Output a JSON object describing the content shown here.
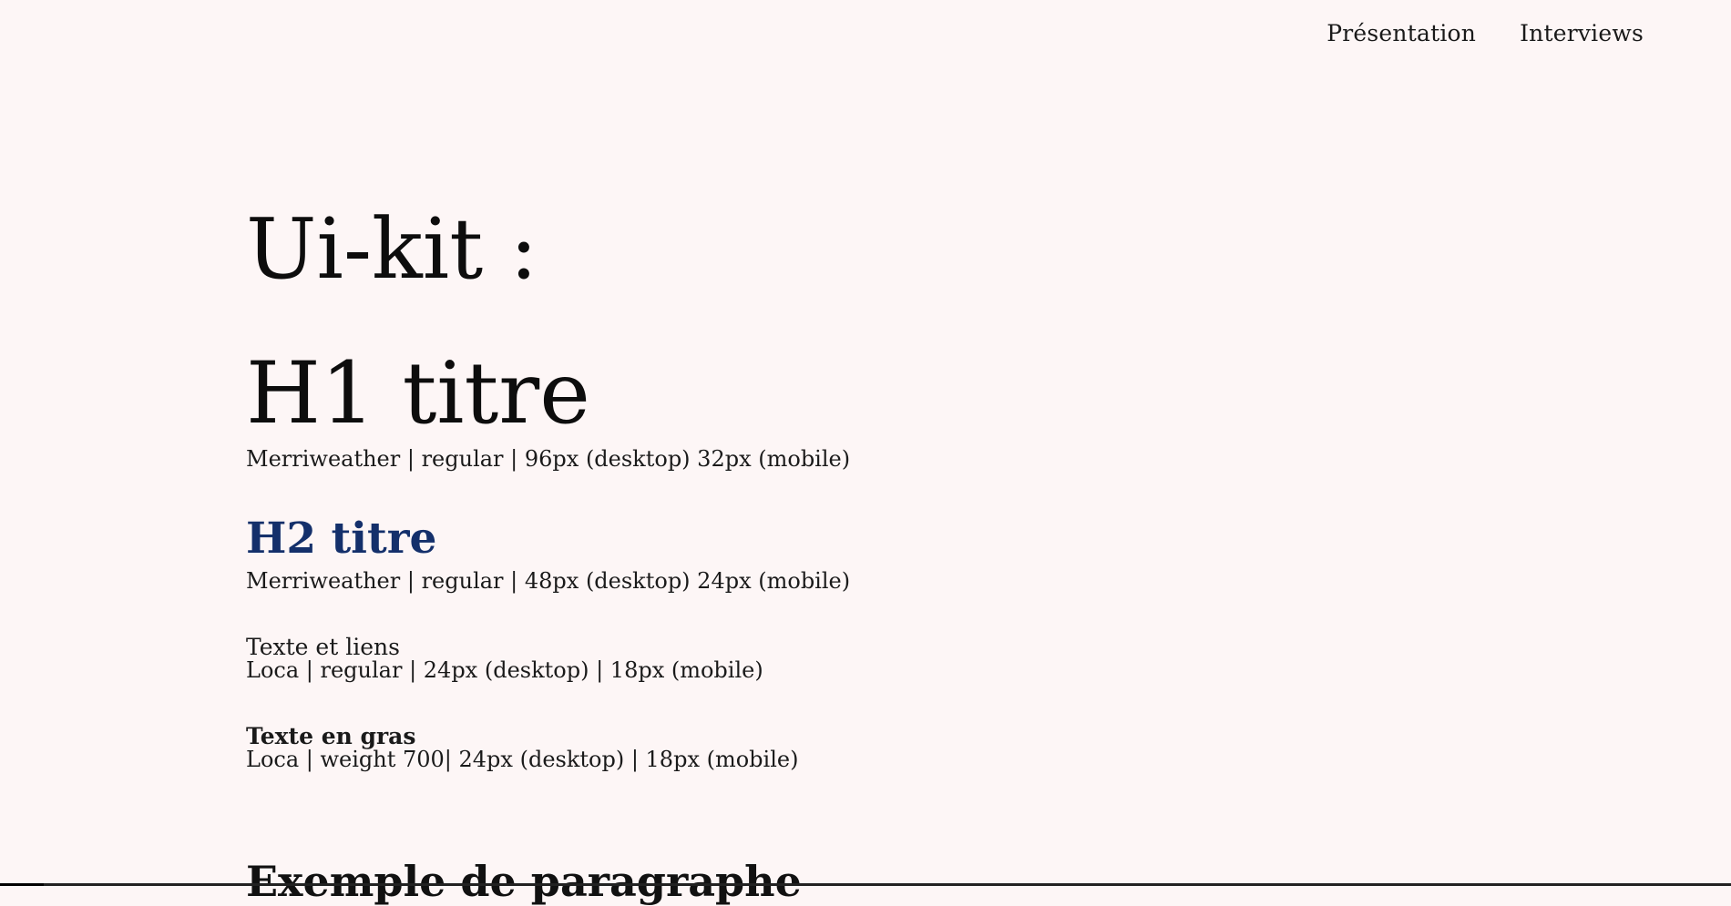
{
  "nav": {
    "items": [
      {
        "label": "Présentation"
      },
      {
        "label": "Interviews"
      }
    ]
  },
  "page": {
    "title": "Ui-kit :"
  },
  "samples": {
    "h1": {
      "label": "H1 titre",
      "spec": "Merriweather | regular | 96px (desktop) 32px (mobile)"
    },
    "h2": {
      "label": "H2 titre",
      "spec": "Merriweather | regular | 48px (desktop) 24px (mobile)"
    },
    "text": {
      "label": "Texte et liens",
      "spec": "Loca | regular | 24px (desktop) | 18px (mobile)"
    },
    "bold": {
      "label": "Texte en gras",
      "spec": "Loca | weight 700| 24px (desktop) | 18px (mobile)"
    },
    "paragraph": {
      "heading": "Exemple de paragraphe"
    }
  },
  "colors": {
    "background": "#fdf6f6",
    "h2": "#14306b",
    "text": "#111111"
  }
}
